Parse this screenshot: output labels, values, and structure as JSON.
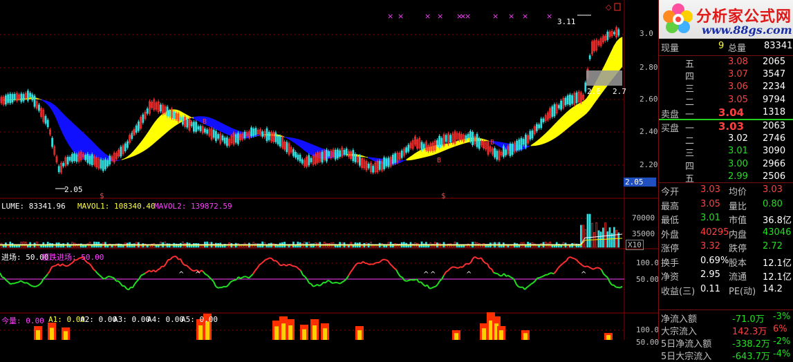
{
  "chart": {
    "price_ticks": [
      "3.0",
      "2.80",
      "2.60",
      "2.40",
      "2.20"
    ],
    "current_price_box": "2.05",
    "annotations": {
      "high": "3.11",
      "low": "2.05",
      "mid_left": "2.6",
      "mid_right": "2.7"
    },
    "b_markers": [
      "B",
      "B",
      "B",
      "B",
      "B"
    ],
    "s_markers": [
      "$",
      "$"
    ],
    "volume_label": "LUME: 83341.96",
    "mavol1_label": "MAVOL1: 108340.40",
    "mavol2_label": "MAVOL2: 139872.59",
    "volume_ticks": [
      "70000",
      "35000"
    ],
    "volume_unit": "X10",
    "osc_label1": "进场: 50.00",
    "osc_label2": "超跌进场: 50.00",
    "osc_ticks": [
      "100.0",
      "50.00"
    ],
    "bottom_labels": [
      "今量: 0.00",
      "A1: 0.00",
      "A2: 0.00",
      "A3: 0.00",
      "A4: 0.00",
      "A5: 0.00"
    ],
    "bottom_ticks": [
      "100.0",
      "50.00"
    ],
    "colors": {
      "up": "#ff3030",
      "down": "#30e0e0",
      "band_yellow": "#ffff00",
      "band_blue": "#1010ff",
      "grid": "#8b0000",
      "magenta": "#ff40ff"
    }
  },
  "quote": {
    "logo_title": "分析家公式网",
    "logo_url": "www.88gs.com",
    "xianliang_label": "现量",
    "xianliang_value": "9",
    "zongliang_label": "总量",
    "zongliang_value": "83341",
    "sell": [
      {
        "label": "五",
        "price": "3.08",
        "vol": "2065"
      },
      {
        "label": "四",
        "price": "3.07",
        "vol": "3547"
      },
      {
        "label": "三",
        "price": "3.06",
        "vol": "2234"
      },
      {
        "label": "二",
        "price": "3.05",
        "vol": "9794"
      },
      {
        "label": "一",
        "price": "3.04",
        "vol": "1318",
        "prefix": "卖盘"
      }
    ],
    "buy": [
      {
        "label": "一",
        "price": "3.03",
        "vol": "2063",
        "prefix": "买盘"
      },
      {
        "label": "二",
        "price": "3.02",
        "vol": "2746"
      },
      {
        "label": "三",
        "price": "3.01",
        "vol": "3090"
      },
      {
        "label": "四",
        "price": "3.00",
        "vol": "2966"
      },
      {
        "label": "五",
        "price": "2.99",
        "vol": "2506"
      }
    ],
    "stats": [
      {
        "l1": "今开",
        "v1": "3.03",
        "c1": "red",
        "l2": "均价",
        "v2": "3.03",
        "c2": "red"
      },
      {
        "l1": "最高",
        "v1": "3.05",
        "c1": "red",
        "l2": "量比",
        "v2": "0.80",
        "c2": "green"
      },
      {
        "l1": "最低",
        "v1": "3.01",
        "c1": "green",
        "l2": "市值",
        "v2": "36.8亿",
        "c2": "white"
      },
      {
        "l1": "外盘",
        "v1": "40295",
        "c1": "red",
        "l2": "内盘",
        "v2": "43046",
        "c2": "green"
      },
      {
        "l1": "涨停",
        "v1": "3.32",
        "c1": "red",
        "l2": "跌停",
        "v2": "2.72",
        "c2": "green"
      },
      {
        "l1": "换手",
        "v1": "0.69%",
        "c1": "white",
        "l2": "股本",
        "v2": "12.1亿",
        "c2": "white"
      },
      {
        "l1": "净资",
        "v1": "2.95",
        "c1": "white",
        "l2": "流通",
        "v2": "12.1亿",
        "c2": "white"
      },
      {
        "l1": "收益(三)",
        "v1": "0.11",
        "c1": "white",
        "l2": "PE(动)",
        "v2": "14.2",
        "c2": "white"
      }
    ],
    "flows": [
      {
        "label": "净流入额",
        "value": "-71.0万",
        "pct": "-3%",
        "c": "green"
      },
      {
        "label": "大宗流入",
        "value": "142.3万",
        "pct": "6%",
        "c": "red"
      },
      {
        "label": "5日净流入额",
        "value": "-338.2万",
        "pct": "-2%",
        "c": "green"
      },
      {
        "label": "5日大宗流入",
        "value": "-643.7万",
        "pct": "-4%",
        "c": "green"
      }
    ]
  }
}
